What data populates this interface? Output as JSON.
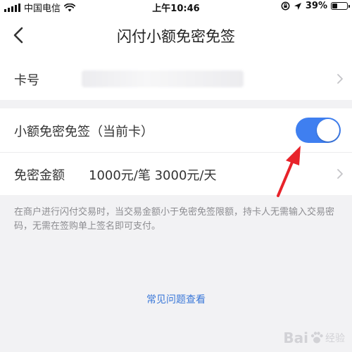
{
  "status_bar": {
    "carrier": "中国电信",
    "time": "上午10:46",
    "battery": "39%",
    "battery_level": 0.39
  },
  "nav": {
    "title": "闪付小额免密免签"
  },
  "card_row": {
    "label": "卡号"
  },
  "toggle_row": {
    "label": "小额免密免签（当前卡）",
    "enabled": true,
    "accent_color": "#3f7ff0"
  },
  "amount_row": {
    "label": "免密金额",
    "value": "1000元/笔 3000元/天"
  },
  "note": "在商户进行闪付交易时，当交易金额小于免密免签限额，持卡人无需输入交易密码，无需在签购单上签名即可支付。",
  "faq_link": "常见问题查看",
  "watermark": {
    "brand": "Bai",
    "suffix": "经验"
  },
  "colors": {
    "link": "#3b78d8",
    "annotation_arrow": "#e8232a"
  }
}
